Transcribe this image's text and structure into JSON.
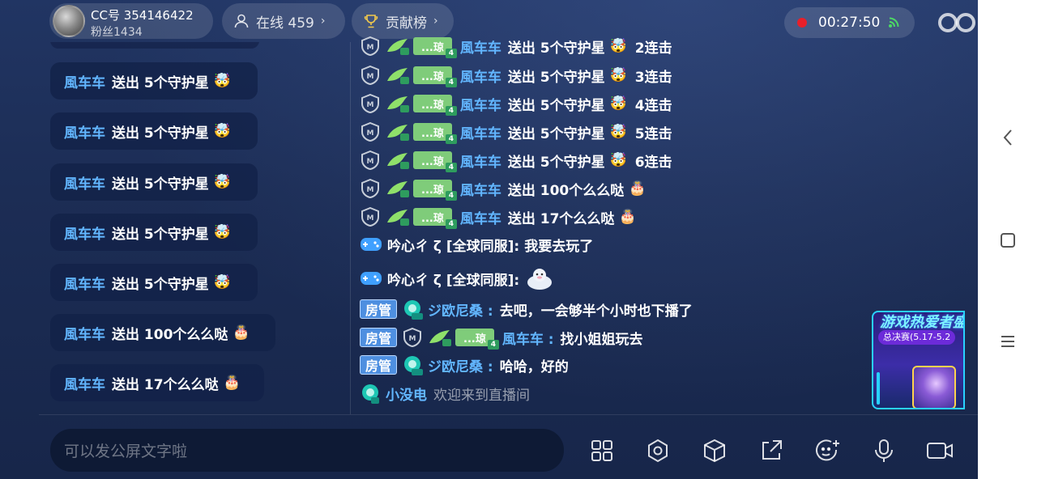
{
  "header": {
    "host_id": "CC号 354146422",
    "host_fans": "粉丝1434",
    "online_label": "在线 459",
    "rank_label": "贡献榜",
    "timer": "00:27:50",
    "watermark": "CC直播"
  },
  "left_banners": [
    {
      "user": "風车车",
      "text": "送出 5个守护星",
      "gift_icon": "guard-star-emoji"
    },
    {
      "user": "風车车",
      "text": "送出 5个守护星",
      "gift_icon": "guard-star-emoji"
    },
    {
      "user": "風车车",
      "text": "送出 5个守护星",
      "gift_icon": "guard-star-emoji"
    },
    {
      "user": "風车车",
      "text": "送出 5个守护星",
      "gift_icon": "guard-star-emoji"
    },
    {
      "user": "風车车",
      "text": "送出 5个守护星",
      "gift_icon": "guard-star-emoji"
    },
    {
      "user": "風车车",
      "text": "送出 100个么么哒",
      "gift_icon": "kiss-gift"
    },
    {
      "user": "風车车",
      "text": "送出 17个么么哒",
      "gift_icon": "kiss-gift"
    }
  ],
  "chat": {
    "top_partial": {
      "badge": "...琼",
      "badge_lv": "4",
      "name": "風车车",
      "text": "送出 5个守护星",
      "combo": "2连击"
    },
    "gift_rows": [
      {
        "badge": "...琼",
        "badge_lv": "4",
        "wing_lv": "3",
        "name": "風车车",
        "text": "送出 5个守护星",
        "combo": "3连击"
      },
      {
        "badge": "...琼",
        "badge_lv": "4",
        "wing_lv": "3",
        "name": "風车车",
        "text": "送出 5个守护星",
        "combo": "4连击"
      },
      {
        "badge": "...琼",
        "badge_lv": "4",
        "wing_lv": "3",
        "name": "風车车",
        "text": "送出 5个守护星",
        "combo": "5连击"
      },
      {
        "badge": "...琼",
        "badge_lv": "4",
        "wing_lv": "3",
        "name": "風车车",
        "text": "送出 5个守护星",
        "combo": "6连击"
      },
      {
        "badge": "...琼",
        "badge_lv": "4",
        "wing_lv": "3",
        "name": "風车车",
        "text": "送出 100个么么哒",
        "combo": ""
      },
      {
        "badge": "...琼",
        "badge_lv": "4",
        "wing_lv": "3",
        "name": "風车车",
        "text": "送出 17个么么哒",
        "combo": ""
      }
    ],
    "msg1": {
      "name": "吟心ㄔ ζ [全球同服]:",
      "text": "我要去玩了"
    },
    "msg2": {
      "name": "吟心ㄔ ζ [全球同服]:"
    },
    "msg3": {
      "role": "房管",
      "lv": "10",
      "name": "ジ欧尼桑 :",
      "text": "去吧，一会够半个小时也下播了"
    },
    "msg4": {
      "role": "房管",
      "badge": "...琼",
      "badge_lv": "4",
      "wing_lv": "3",
      "name": "風车车 :",
      "text": "找小姐姐玩去"
    },
    "msg5": {
      "role": "房管",
      "lv": "10",
      "name": "ジ欧尼桑 :",
      "text": "哈哈，好的"
    },
    "msg6": {
      "lv": "5",
      "name": "小没电",
      "text": "欢迎来到直播间"
    }
  },
  "event": {
    "title": "游戏热爱者盛典",
    "subtitle": "总决赛(5.17-5.2"
  },
  "input": {
    "placeholder": "可以发公屏文字啦"
  },
  "toolbar": [
    "grid-icon",
    "settings-icon",
    "cube-icon",
    "share-icon",
    "emoji-icon",
    "mic-icon",
    "camera-icon"
  ],
  "colors": {
    "accent_name": "#62b6ff",
    "rec_red": "#e8202a",
    "fan_badge": "#7fcc7a",
    "admin": "#4e8fe0"
  }
}
